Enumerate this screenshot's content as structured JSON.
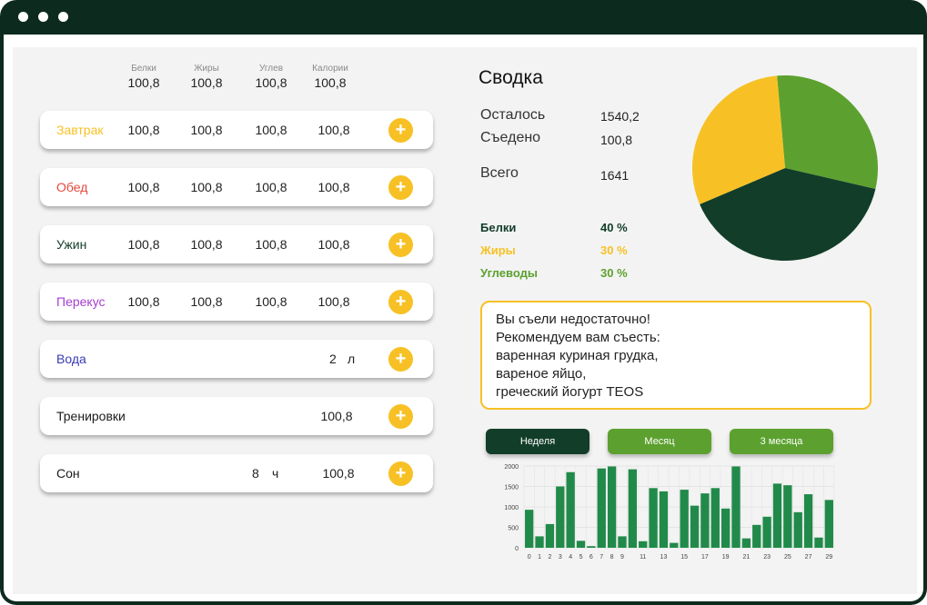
{
  "colors": {
    "frame": "#0d2a1e",
    "accent_yellow": "#f7c125",
    "dark_green": "#123d29",
    "mid_green": "#5ca12f",
    "bar_green": "#218a4a",
    "breakfast": "#f7c125",
    "lunch": "#e5483e",
    "dinner": "#123d29",
    "snack": "#a53fd1",
    "water": "#3a3ab4",
    "protein": "#123d29",
    "fat": "#f7c125",
    "carbs": "#5ca12f"
  },
  "columns": {
    "protein": {
      "label": "Белки",
      "value": "100,8"
    },
    "fat": {
      "label": "Жиры",
      "value": "100,8"
    },
    "carbs": {
      "label": "Углев",
      "value": "100,8"
    },
    "calories": {
      "label": "Калории",
      "value": "100,8"
    }
  },
  "meals": [
    {
      "name": "Завтрак",
      "protein": "100,8",
      "fat": "100,8",
      "carbs": "100,8",
      "calories": "100,8"
    },
    {
      "name": "Обед",
      "protein": "100,8",
      "fat": "100,8",
      "carbs": "100,8",
      "calories": "100,8"
    },
    {
      "name": "Ужин",
      "protein": "100,8",
      "fat": "100,8",
      "carbs": "100,8",
      "calories": "100,8"
    },
    {
      "name": "Перекус",
      "protein": "100,8",
      "fat": "100,8",
      "carbs": "100,8",
      "calories": "100,8"
    }
  ],
  "water": {
    "name": "Вода",
    "amount": "2",
    "unit": "л"
  },
  "training": {
    "name": "Тренировки",
    "value": "100,8"
  },
  "sleep": {
    "name": "Сон",
    "amount": "8",
    "unit": "ч",
    "value": "100,8"
  },
  "add_icon": "plus-icon",
  "summary": {
    "title": "Сводка",
    "remaining_label": "Осталось",
    "remaining_value": "1540,2",
    "eaten_label": "Съедено",
    "eaten_value": "100,8",
    "total_label": "Всего",
    "total_value": "1641"
  },
  "macros": [
    {
      "label": "Белки",
      "value": "40 %",
      "percent": 40
    },
    {
      "label": "Жиры",
      "value": "30 %",
      "percent": 30
    },
    {
      "label": "Углеводы",
      "value": "30 %",
      "percent": 30
    }
  ],
  "advice": {
    "line1": "Вы съели недостаточно!",
    "line2": "Рекомендуем вам съесть:",
    "line3": "варенная куриная грудка,",
    "line4": "вареное яйцо,",
    "line5": "греческий йогурт TEOS"
  },
  "tabs": [
    {
      "label": "Неделя",
      "active": true
    },
    {
      "label": "Месяц",
      "active": false
    },
    {
      "label": "3 месяца",
      "active": false
    }
  ],
  "chart_data": {
    "type": "bar",
    "categories": [
      "0",
      "1",
      "2",
      "3",
      "4",
      "5",
      "6",
      "7",
      "8",
      "9",
      "10",
      "11",
      "12",
      "13",
      "14",
      "15",
      "16",
      "17",
      "18",
      "19",
      "20",
      "21",
      "22",
      "23",
      "24",
      "25",
      "26",
      "27",
      "28",
      "29"
    ],
    "x_tick_labels": [
      "0",
      "1",
      "2",
      "3",
      "4",
      "5",
      "6",
      "7",
      "8",
      "9",
      "11",
      "13",
      "15",
      "17",
      "19",
      "21",
      "23",
      "25",
      "27",
      "29"
    ],
    "values": [
      930,
      280,
      580,
      1500,
      1850,
      170,
      40,
      1940,
      1990,
      280,
      1920,
      160,
      1460,
      1380,
      120,
      1420,
      1030,
      1330,
      1460,
      960,
      1990,
      230,
      560,
      760,
      1570,
      1530,
      870,
      1310,
      250,
      1170
    ],
    "ylim": [
      0,
      2000
    ],
    "y_ticks": [
      0,
      500,
      1000,
      1500,
      2000
    ],
    "grid": true,
    "title": "",
    "xlabel": "",
    "ylabel": ""
  }
}
